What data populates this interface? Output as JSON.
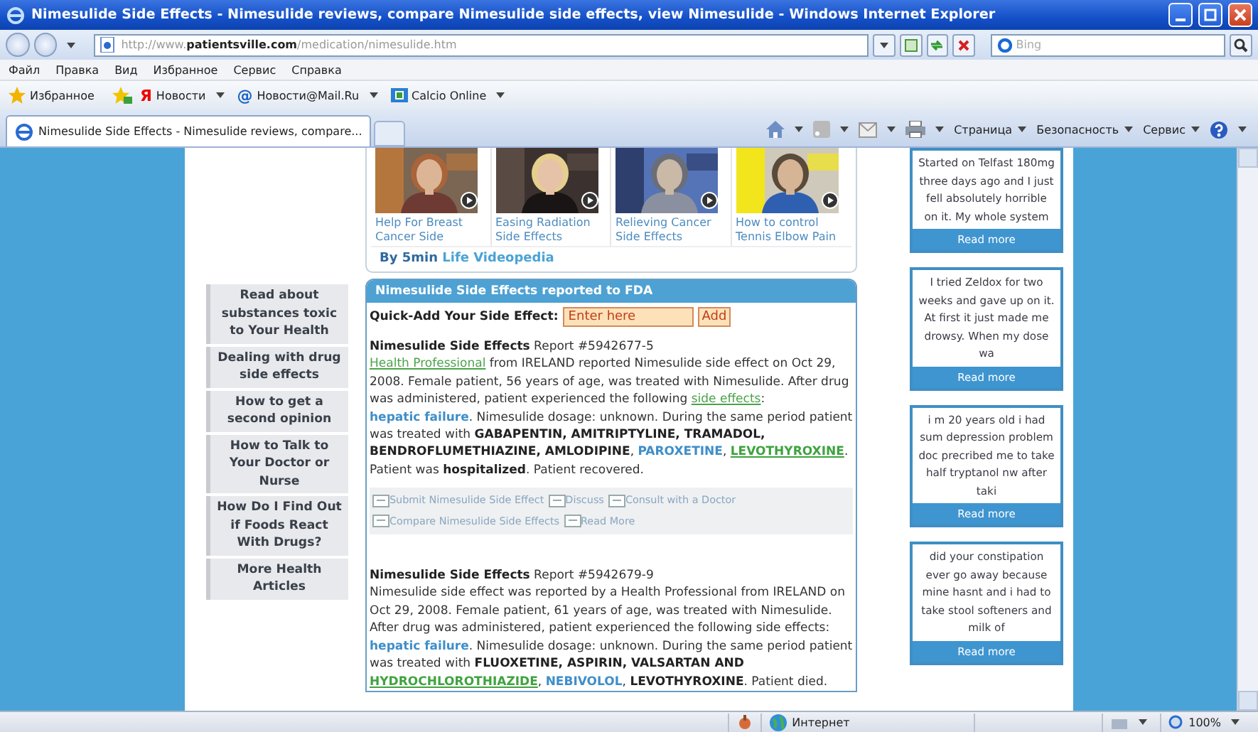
{
  "window": {
    "title": "Nimesulide Side Effects - Nimesulide reviews, compare Nimesulide side effects, view Nimesulide  - Windows Internet Explorer"
  },
  "address_bar": {
    "url": "http://www.**patientsville.com**/medication/nimesulide.htm",
    "search_placeholder": "Bing"
  },
  "menu": [
    "Файл",
    "Правка",
    "Вид",
    "Избранное",
    "Сервис",
    "Справка"
  ],
  "favorites_bar": {
    "favorites": "Избранное",
    "links": [
      {
        "kind": "yandex",
        "glyph": "Я",
        "label": "Новости"
      },
      {
        "kind": "mail",
        "glyph": "@",
        "label": "Новости@Mail.Ru"
      },
      {
        "kind": "slice",
        "label": "Calcio Online"
      }
    ]
  },
  "tabs": [
    {
      "label": "Nimesulide Side Effects - Nimesulide reviews, compare...",
      "selected": true
    }
  ],
  "command_bar": [
    "Страница",
    "Безопасность",
    "Сервис"
  ],
  "sidebar": {
    "items": [
      "Read about substances toxic to Your Health",
      "Dealing with drug side effects",
      "How to get a second opinion",
      "How to Talk to Your Doctor or Nurse",
      "How Do I Find Out if Foods React With Drugs?",
      "More Health Articles"
    ]
  },
  "videos": {
    "items": [
      {
        "caption": "Help For Breast Cancer Side"
      },
      {
        "caption": "Easing Radiation Side Effects"
      },
      {
        "caption": "Relieving Cancer Side Effects"
      },
      {
        "caption": "How to control Tennis Elbow Pain"
      }
    ],
    "credit": "By 5min",
    "credit_link": "Life Videopedia"
  },
  "fda_panel": {
    "title": "Nimesulide Side Effects reported to FDA",
    "quick_add": {
      "label": "Quick-Add Your Side Effect:",
      "placeholder": "Enter here",
      "button": "Add"
    },
    "reports": [
      {
        "heading": "**Nimesulide Side Effects** Report #5942677-5",
        "segments": [
          {
            "kind": "link",
            "text": "Health Professional"
          },
          {
            "kind": "text",
            "text": " from IRELAND reported Nimesulide side effect on Oct 29, 2008. Female patient, 56 years of age, was treated with Nimesulide. After drug was administered, patient experienced the following "
          },
          {
            "kind": "link",
            "text": "side effects"
          },
          {
            "kind": "text",
            "text": ": "
          },
          {
            "kind": "term",
            "text": "hepatic failure"
          },
          {
            "kind": "text",
            "text": ". Nimesulide dosage: unknown. During the same period patient was treated with "
          },
          {
            "kind": "bold",
            "text": "GABAPENTIN, AMITRIPTYLINE, TRAMADOL, BENDROFLUMETHIAZINE, AMLODIPINE"
          },
          {
            "kind": "text",
            "text": ", "
          },
          {
            "kind": "term",
            "text": "PAROXETINE"
          },
          {
            "kind": "text",
            "text": ", "
          },
          {
            "kind": "drug",
            "text": "LEVOTHYROXINE"
          },
          {
            "kind": "text",
            "text": ". Patient was "
          },
          {
            "kind": "bold",
            "text": "hospitalized"
          },
          {
            "kind": "text",
            "text": ". Patient recovered."
          }
        ],
        "actions": [
          "Submit Nimesulide Side Effect",
          "Discuss",
          "Consult with a Doctor",
          "Compare Nimesulide Side Effects",
          "Read More"
        ]
      },
      {
        "heading": "**Nimesulide Side Effects** Report #5942679-9",
        "segments": [
          {
            "kind": "text",
            "text": "Nimesulide side effect was reported by a Health Professional from IRELAND on Oct 29, 2008. Female patient, 61 years of age, was treated with Nimesulide. After drug was administered, patient experienced the following side effects: "
          },
          {
            "kind": "term",
            "text": "hepatic failure"
          },
          {
            "kind": "text",
            "text": ". Nimesulide dosage: unknown. During the same period patient was treated with "
          },
          {
            "kind": "bold",
            "text": "FLUOXETINE, ASPIRIN, VALSARTAN AND "
          },
          {
            "kind": "drug",
            "text": "HYDROCHLOROTHIAZIDE"
          },
          {
            "kind": "text",
            "text": ", "
          },
          {
            "kind": "term",
            "text": "NEBIVOLOL"
          },
          {
            "kind": "text",
            "text": ", "
          },
          {
            "kind": "bold",
            "text": "LEVOTHYROXINE"
          },
          {
            "kind": "text",
            "text": ". Patient died."
          }
        ]
      }
    ]
  },
  "comments": [
    {
      "text": "Started on Telfast 180mg three days ago and I just fell absolutely horrible on it. My whole system",
      "button": "Read more"
    },
    {
      "text": "I tried Zeldox for two weeks and gave up on it. At first it just made me drowsy. When my dose wa",
      "button": "Read more"
    },
    {
      "text": "i m 20 years old i had sum depression problem doc precribed me to take half tryptanol nw after taki",
      "button": "Read more"
    },
    {
      "text": "did your constipation ever go away because mine hasnt and i had to take stool softeners and milk of",
      "button": "Read more"
    }
  ],
  "status_bar": {
    "zone": "Интернет",
    "zoom": "100%"
  }
}
